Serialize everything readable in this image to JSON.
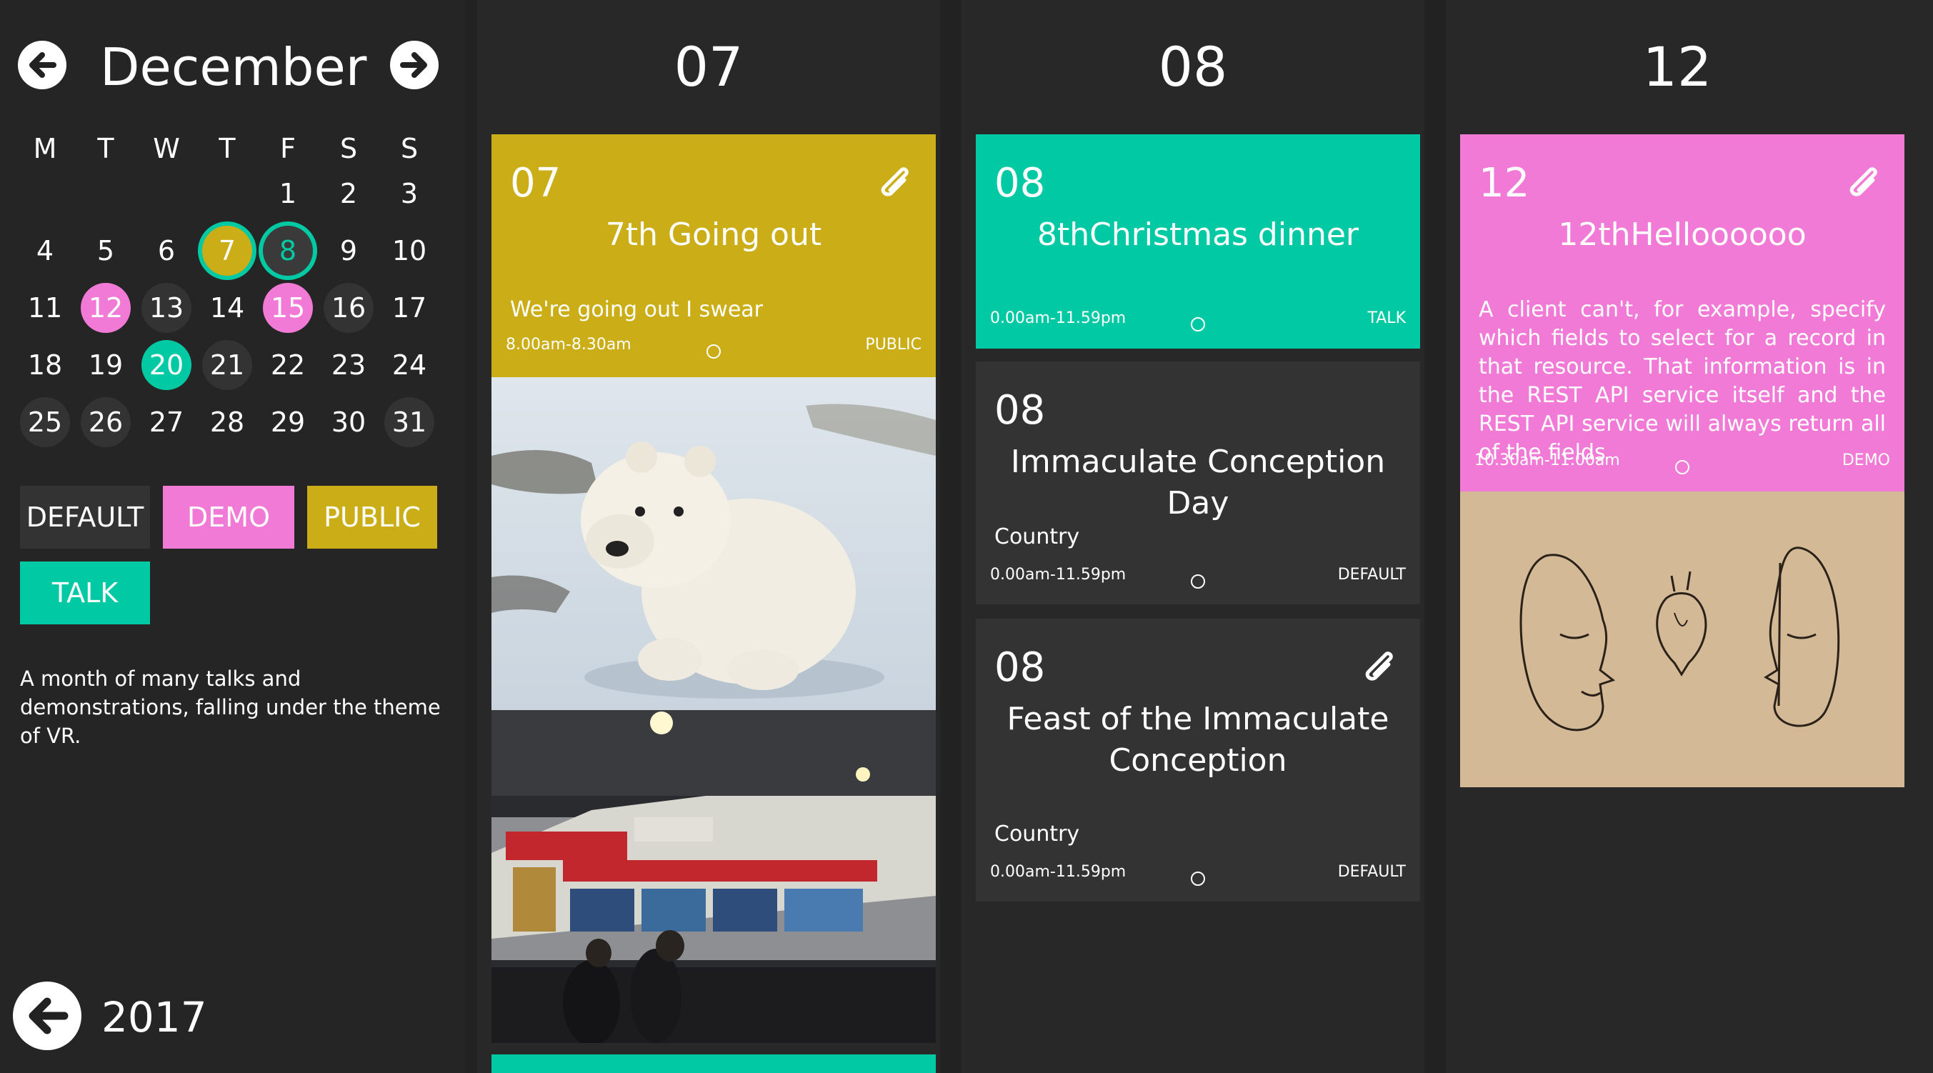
{
  "colors": {
    "default": "#333333",
    "demo": "#f07ad6",
    "public": "#caad17",
    "talk": "#00c9a3"
  },
  "sidebar": {
    "month": "December",
    "prev_icon": "arrow-left-circle-icon",
    "next_icon": "arrow-right-circle-icon",
    "weekdays": [
      "M",
      "T",
      "W",
      "T",
      "F",
      "S",
      "S"
    ],
    "days": [
      "1",
      "2",
      "3",
      "4",
      "5",
      "6",
      "7",
      "8",
      "9",
      "10",
      "11",
      "12",
      "13",
      "14",
      "15",
      "16",
      "17",
      "18",
      "19",
      "20",
      "21",
      "22",
      "23",
      "24",
      "25",
      "26",
      "27",
      "28",
      "29",
      "30",
      "31"
    ],
    "tags": [
      "DEFAULT",
      "DEMO",
      "PUBLIC",
      "TALK"
    ],
    "description": "A month of many talks and demonstrations, falling under the theme of VR.",
    "back_icon": "arrow-left-circle-icon",
    "year": "2017"
  },
  "columns": [
    {
      "day": "07",
      "events": [
        {
          "num": "07",
          "title": "7th Going out",
          "desc": "We're going out I swear",
          "time": "8.00am-8.30am",
          "tag": "PUBLIC",
          "attachment_icon": "paperclip-icon"
        }
      ],
      "images": [
        "polar-bear-cub-photo",
        "tech-expo-booth-photo"
      ]
    },
    {
      "day": "08",
      "events": [
        {
          "num": "08",
          "title": "8thChristmas dinner",
          "time": "0.00am-11.59pm",
          "tag": "TALK"
        },
        {
          "num": "08",
          "title": "Immaculate Conception Day",
          "desc": "Country",
          "time": "0.00am-11.59pm",
          "tag": "DEFAULT"
        },
        {
          "num": "08",
          "title": "Feast of the Immaculate Conception",
          "desc": "Country",
          "time": "0.00am-11.59pm",
          "tag": "DEFAULT",
          "attachment_icon": "paperclip-icon"
        }
      ]
    },
    {
      "day": "12",
      "events": [
        {
          "num": "12",
          "title": "12thHelloooooo",
          "desc": "A client can't, for example, specify which fields to select for a record in that resource. That information is in the REST API service itself and the REST API service will always return all of the fields",
          "time": "10.30am-11.00am",
          "tag": "DEMO",
          "attachment_icon": "paperclip-icon"
        }
      ],
      "images": [
        "faces-heart-sketch-photo"
      ]
    }
  ]
}
